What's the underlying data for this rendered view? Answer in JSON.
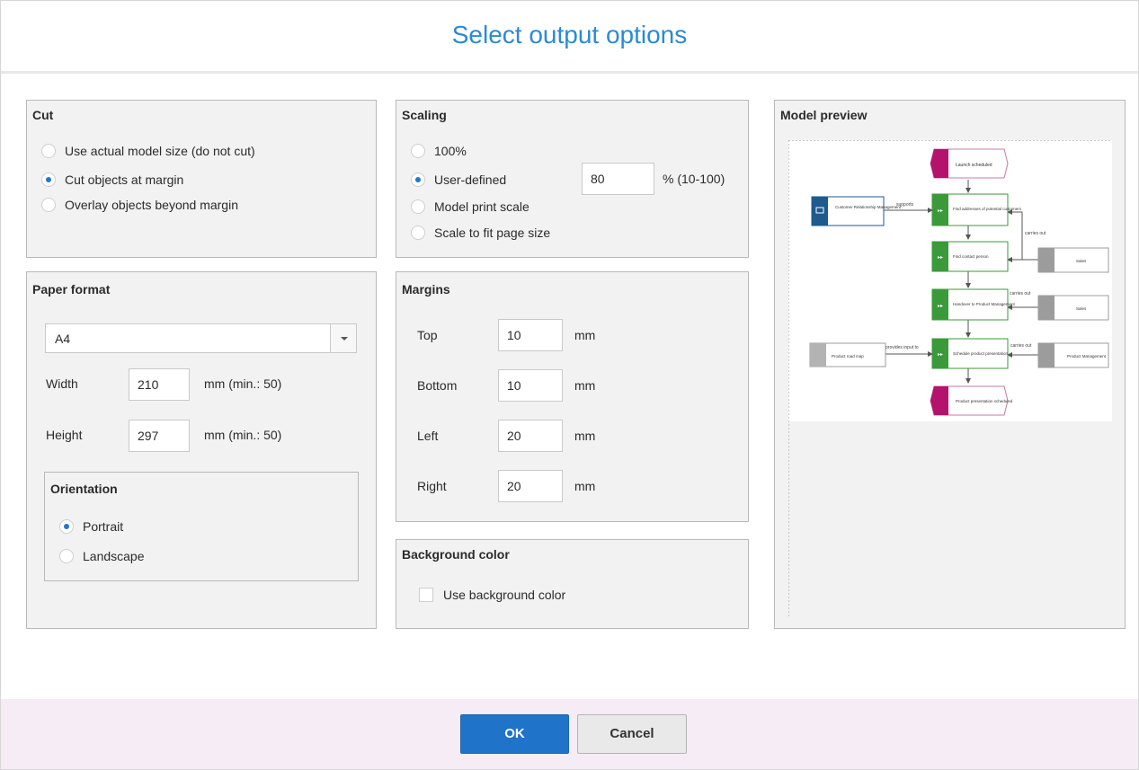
{
  "dialog": {
    "title": "Select output options"
  },
  "cut": {
    "title": "Cut",
    "options": [
      "Use actual model size (do not cut)",
      "Cut objects at margin",
      "Overlay objects beyond margin"
    ],
    "selected_index": 1
  },
  "scaling": {
    "title": "Scaling",
    "options": [
      "100%",
      "User-defined",
      "Model print scale",
      "Scale to fit page size"
    ],
    "selected_index": 1,
    "user_defined_value": "80",
    "user_defined_unit": "% (10-100)"
  },
  "paper_format": {
    "title": "Paper format",
    "format_value": "A4",
    "width_label": "Width",
    "width_value": "210",
    "width_unit": "mm (min.: 50)",
    "height_label": "Height",
    "height_value": "297",
    "height_unit": "mm (min.: 50)",
    "orientation": {
      "title": "Orientation",
      "options": [
        "Portrait",
        "Landscape"
      ],
      "selected_index": 0
    }
  },
  "margins": {
    "title": "Margins",
    "top_label": "Top",
    "top_value": "10",
    "bottom_label": "Bottom",
    "bottom_value": "10",
    "left_label": "Left",
    "left_value": "20",
    "right_label": "Right",
    "right_value": "20",
    "unit": "mm"
  },
  "background": {
    "title": "Background color",
    "checkbox_label": "Use background color",
    "checked": false
  },
  "preview": {
    "title": "Model preview",
    "nodes": {
      "event_start": "Launch scheduled",
      "org_crm": "Customer Relationship Management",
      "func_1": "Find addresses of potential customers",
      "func_2": "Find contact person",
      "func_3": "Handover to Product Management",
      "func_4": "Schedule product presentation",
      "event_end": "Product presentation scheduled",
      "role_sales_1": "Sales",
      "role_sales_2": "Sales",
      "role_pm": "Product Management",
      "doc_contact": "Product road map"
    },
    "edges": {
      "supports": "supports",
      "carries_out_1": "carries out",
      "carries_out_2": "carries out",
      "carries_out_3": "carries out",
      "provides_input": "provides input to"
    }
  },
  "footer": {
    "ok_label": "OK",
    "cancel_label": "Cancel"
  },
  "colors": {
    "title": "#2a8ad8",
    "accent": "#1f73c8",
    "footer_bg": "#f6ecf5",
    "function_green": "#3a9a3a",
    "event_magenta": "#b5126e",
    "org_blue": "#1d5a8e",
    "role_gray": "#9c9c9c"
  }
}
